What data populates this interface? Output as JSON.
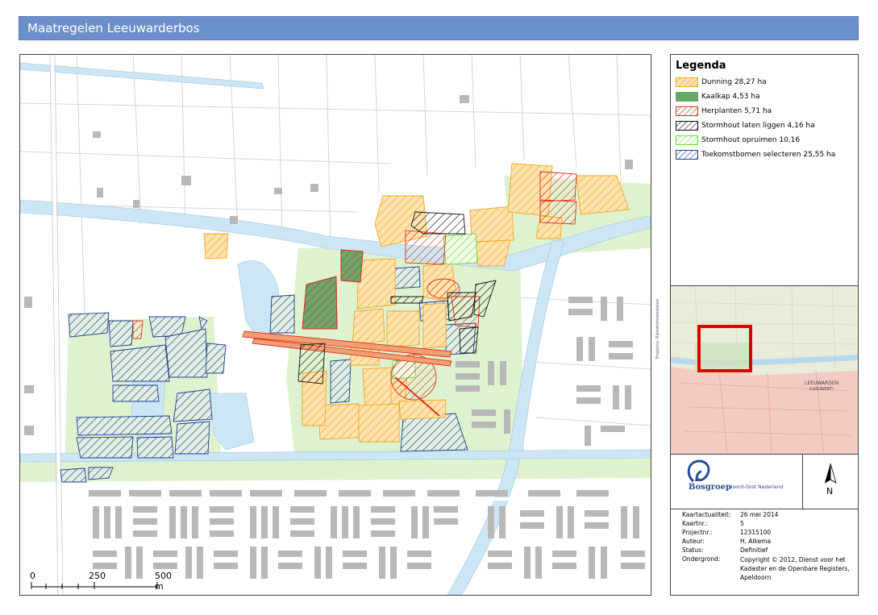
{
  "header": {
    "title": "Maatregelen Leeuwarderbos"
  },
  "map": {
    "projection_note": "Projectie: Rijksdriehoekstelsel",
    "scalebar": {
      "labels": [
        "0",
        "250",
        "500 m"
      ]
    }
  },
  "legend": {
    "title": "Legenda",
    "items": [
      {
        "label": "Dunning 28,27 ha",
        "color": "#f5a623",
        "pattern": "hatch",
        "fill": "#fde3b0"
      },
      {
        "label": "Kaalkap 4,53 ha",
        "color": "#6aa86a",
        "pattern": "solid",
        "fill": "#6aa86a"
      },
      {
        "label": "Herplanten 5,71 ha",
        "color": "#e03020",
        "pattern": "hatch",
        "fill": "#ffffff"
      },
      {
        "label": "Stormhout laten liggen 4,16 ha",
        "color": "#111111",
        "pattern": "hatch",
        "fill": "#ffffff"
      },
      {
        "label": "Stormhout opruimen 10,16",
        "color": "#66dd33",
        "pattern": "hatch",
        "fill": "#ffffff"
      },
      {
        "label": "Toekomstbomen selecteren 25,55 ha",
        "color": "#1f3f8f",
        "pattern": "hatch",
        "fill": "#ffffff"
      }
    ]
  },
  "overview": {
    "city_label_1": "LEEUWARDEN",
    "city_label_2": "(LJOUWERT)"
  },
  "logo": {
    "name": "Bosgroep",
    "subtitle": "Noord-Oost Nederland"
  },
  "north": {
    "label": "N"
  },
  "info": {
    "rows": [
      {
        "key": "Kaartactualiteit:",
        "value": "26 mei 2014"
      },
      {
        "key": "Kaartnr.:",
        "value": "5"
      },
      {
        "key": "Projectnr.:",
        "value": "12315100"
      },
      {
        "key": "Auteur:",
        "value": "H. Alkema"
      },
      {
        "key": "Status:",
        "value": "Definitief"
      },
      {
        "key": "Ondergrond:",
        "value": "Copyright © 2012, Dienst voor het Kadaster en de Openbare Registers, Apeldoorn"
      }
    ]
  },
  "colors": {
    "water": "#cde6f5",
    "green": "#dff2d0",
    "building": "#b8b8b8",
    "road": "#ffffff",
    "dunning": "#f5a623",
    "herplanten": "#e03020",
    "kaalkap": "#6aa86a",
    "storm_laten": "#111111",
    "storm_opruimen": "#66dd33",
    "toekomst": "#1f3f8f"
  }
}
